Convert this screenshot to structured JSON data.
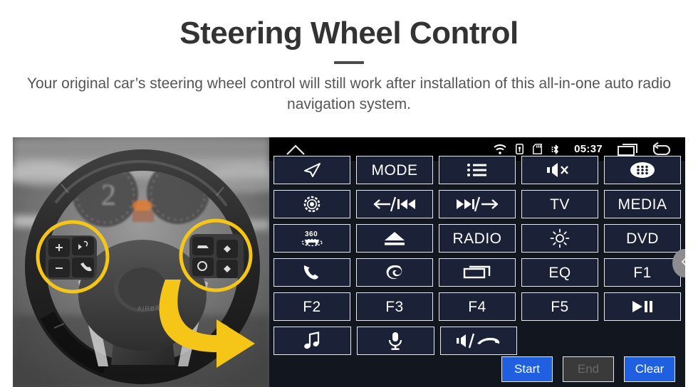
{
  "header": {
    "title": "Steering Wheel Control",
    "subtitle": "Your original car’s steering wheel control will still work after installation of this all-in-one auto radio navigation system."
  },
  "photo": {
    "alt": "Car steering wheel with two highlighted control button clusters",
    "highlight_color": "#f5c518",
    "arrow_color": "#f5c518"
  },
  "unit": {
    "statusbar": {
      "home_icon": "home-icon",
      "icons": [
        "wifi-icon",
        "usb-lock-icon",
        "sd-card-icon",
        "bluetooth-icon"
      ],
      "clock": "05:37",
      "recents_icon": "recents-icon",
      "back_icon": "back-icon"
    },
    "rows": [
      [
        {
          "name": "navigation",
          "icon": "navigation-arrow-icon",
          "label": ""
        },
        {
          "name": "mode",
          "icon": "",
          "label": "MODE"
        },
        {
          "name": "list",
          "icon": "list-icon",
          "label": ""
        },
        {
          "name": "mute",
          "icon": "mute-icon",
          "label": ""
        },
        {
          "name": "apps",
          "icon": "apps-grid-icon",
          "label": ""
        }
      ],
      [
        {
          "name": "settings",
          "icon": "settings-gear-icon",
          "label": ""
        },
        {
          "name": "back-prev",
          "icon": "back-prev-track-icon",
          "label": ""
        },
        {
          "name": "next-forward",
          "icon": "next-track-forward-icon",
          "label": ""
        },
        {
          "name": "tv",
          "icon": "",
          "label": "TV"
        },
        {
          "name": "media",
          "icon": "",
          "label": "MEDIA"
        }
      ],
      [
        {
          "name": "camera-360",
          "icon": "camera-360-icon",
          "label": ""
        },
        {
          "name": "eject",
          "icon": "eject-icon",
          "label": ""
        },
        {
          "name": "radio",
          "icon": "",
          "label": "RADIO"
        },
        {
          "name": "brightness",
          "icon": "brightness-icon",
          "label": ""
        },
        {
          "name": "dvd",
          "icon": "",
          "label": "DVD"
        }
      ],
      [
        {
          "name": "phone",
          "icon": "phone-icon",
          "label": ""
        },
        {
          "name": "swirl",
          "icon": "swirl-icon",
          "label": ""
        },
        {
          "name": "window",
          "icon": "window-icon",
          "label": ""
        },
        {
          "name": "eq",
          "icon": "",
          "label": "EQ"
        },
        {
          "name": "f1",
          "icon": "",
          "label": "F1"
        }
      ],
      [
        {
          "name": "f2",
          "icon": "",
          "label": "F2"
        },
        {
          "name": "f3",
          "icon": "",
          "label": "F3"
        },
        {
          "name": "f4",
          "icon": "",
          "label": "F4"
        },
        {
          "name": "f5",
          "icon": "",
          "label": "F5"
        },
        {
          "name": "play-pause",
          "icon": "play-pause-icon",
          "label": ""
        }
      ],
      [
        {
          "name": "music",
          "icon": "music-note-icon",
          "label": ""
        },
        {
          "name": "voice",
          "icon": "microphone-icon",
          "label": ""
        },
        {
          "name": "volume-hangup",
          "icon": "volume-hangup-icon",
          "label": ""
        }
      ]
    ],
    "actions": [
      {
        "name": "start",
        "label": "Start",
        "state": "enabled"
      },
      {
        "name": "end",
        "label": "End",
        "state": "disabled"
      },
      {
        "name": "clear",
        "label": "Clear",
        "state": "enabled"
      }
    ],
    "drawer_tab_icon": "chevron-left-icon",
    "colors": {
      "panel_bg": "#11161f",
      "key_bg": "#1b2237",
      "key_border": "#e8eaf0",
      "action_blue": "#1f5fe0",
      "action_disabled": "#3a3a3a"
    }
  }
}
